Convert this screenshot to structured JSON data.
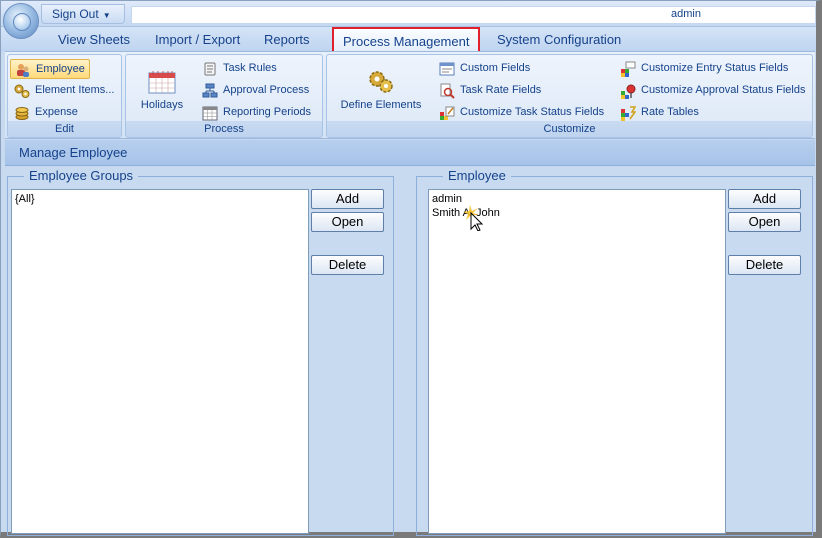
{
  "app": {
    "signout_label": "Sign Out",
    "user_name": "admin"
  },
  "tabs": [
    {
      "label": "View Sheets"
    },
    {
      "label": "Import / Export"
    },
    {
      "label": "Reports"
    },
    {
      "label": "Process Management"
    },
    {
      "label": "System Configuration"
    }
  ],
  "ribbon": {
    "edit": {
      "label": "Edit",
      "items": [
        {
          "label": "Employee",
          "icon": "employee-icon"
        },
        {
          "label": "Element Items...",
          "icon": "gears-icon"
        },
        {
          "label": "Expense",
          "icon": "coins-icon"
        }
      ]
    },
    "process": {
      "label": "Process",
      "big_button": {
        "label": "Holidays",
        "icon": "calendar-icon"
      },
      "items": [
        {
          "label": "Task Rules",
          "icon": "scroll-icon"
        },
        {
          "label": "Approval Process",
          "icon": "flowchart-icon"
        },
        {
          "label": "Reporting Periods",
          "icon": "calendar-grid-icon"
        }
      ]
    },
    "customize": {
      "label": "Customize",
      "big_button": {
        "label": "Define Elements",
        "icon": "gears-icon"
      },
      "col1": [
        {
          "label": "Custom Fields",
          "icon": "form-icon"
        },
        {
          "label": "Task Rate Fields",
          "icon": "magnify-icon"
        },
        {
          "label": "Customize Task Status Fields",
          "icon": "status-edit-icon"
        }
      ],
      "col2": [
        {
          "label": "Customize Entry Status Fields",
          "icon": "status-grid-icon"
        },
        {
          "label": "Customize Approval Status Fields",
          "icon": "status-pin-icon"
        },
        {
          "label": "Rate Tables",
          "icon": "rate-table-icon"
        }
      ]
    }
  },
  "manage_title": "Manage Employee",
  "employee_groups": {
    "legend": "Employee Groups",
    "items": [
      "{All}"
    ],
    "add_label": "Add",
    "open_label": "Open",
    "delete_label": "Delete"
  },
  "employee": {
    "legend": "Employee",
    "items": [
      "admin",
      "Smith A, John"
    ],
    "add_label": "Add",
    "open_label": "Open",
    "delete_label": "Delete"
  },
  "colors": {
    "accent": "#15428b",
    "highlight_border": "#e0202a",
    "panel_bg": "#c8daf0"
  }
}
